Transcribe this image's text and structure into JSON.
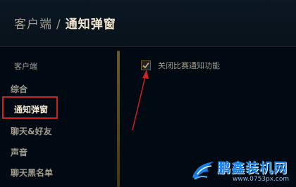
{
  "header": {
    "breadcrumb_parent": "客户端",
    "separator": "/",
    "breadcrumb_current": "通知弹窗"
  },
  "sidebar": {
    "group_label": "客户端",
    "items": [
      {
        "label": "综合"
      },
      {
        "label": "通知弹窗"
      },
      {
        "label": "聊天&好友"
      },
      {
        "label": "声音"
      },
      {
        "label": "聊天黑名单"
      }
    ]
  },
  "settings": {
    "disable_match_notifications": {
      "label": "关闭比赛通知功能",
      "checked": true
    }
  },
  "watermark": {
    "name": "鹏鑫装机网",
    "url": "www.0753px.com"
  },
  "colors": {
    "background": "#010a13",
    "gold": "#cdbe91",
    "highlight_box": "#cc2222",
    "arrow": "#cc2222"
  },
  "icons": {
    "checkbox": "check-mark-icon",
    "watermark_logo": "bird-logo-icon"
  }
}
